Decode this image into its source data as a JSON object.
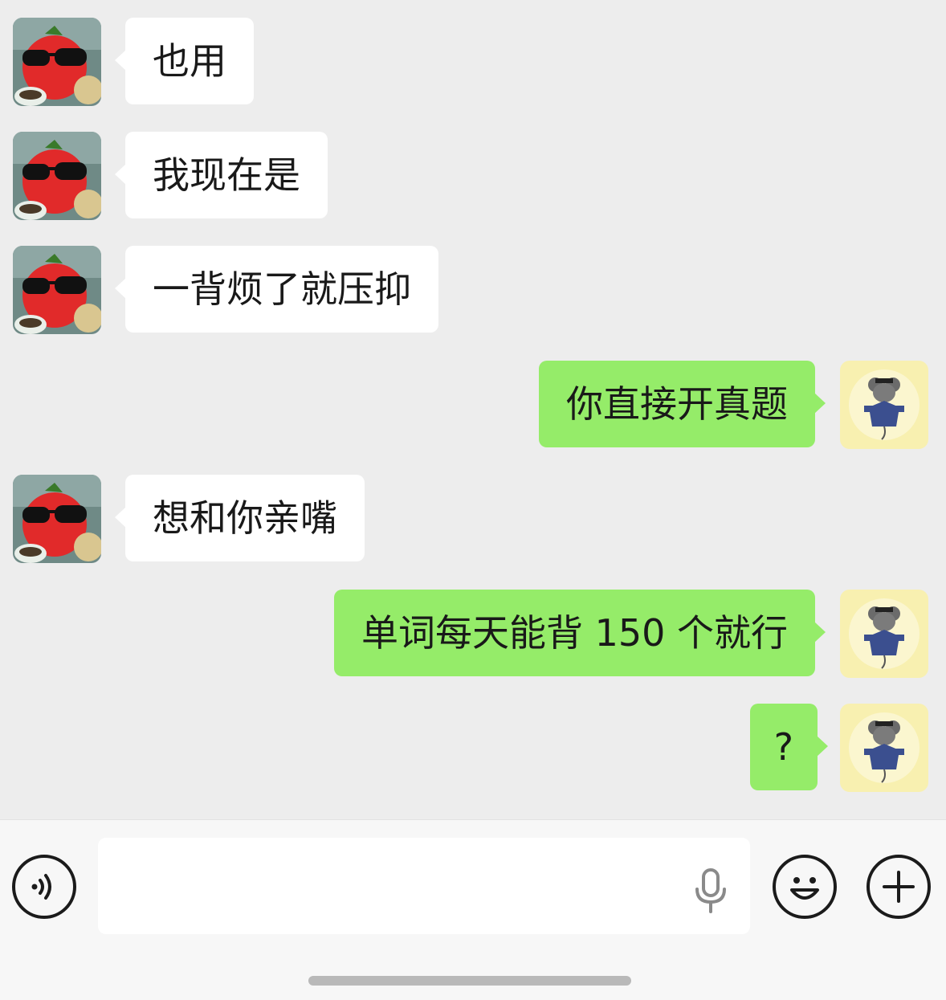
{
  "messages": [
    {
      "side": "in",
      "text": "也用"
    },
    {
      "side": "in",
      "text": "我现在是"
    },
    {
      "side": "in",
      "text": "一背烦了就压抑"
    },
    {
      "side": "out",
      "text": "你直接开真题"
    },
    {
      "side": "in",
      "text": "想和你亲嘴"
    },
    {
      "side": "out",
      "text": "单词每天能背 150 个就行"
    },
    {
      "side": "out",
      "text": "?"
    }
  ],
  "colors": {
    "background": "#ededed",
    "incoming_bubble": "#ffffff",
    "outgoing_bubble": "#95ec69",
    "text": "#191919"
  },
  "avatars": {
    "incoming": "tomato-with-sunglasses-avatar",
    "outgoing": "graduate-mouse-avatar"
  },
  "input_bar": {
    "voice_icon": "voice-mode-icon",
    "mic_icon": "microphone-icon",
    "emoji_icon": "emoji-icon",
    "plus_icon": "plus-icon"
  }
}
